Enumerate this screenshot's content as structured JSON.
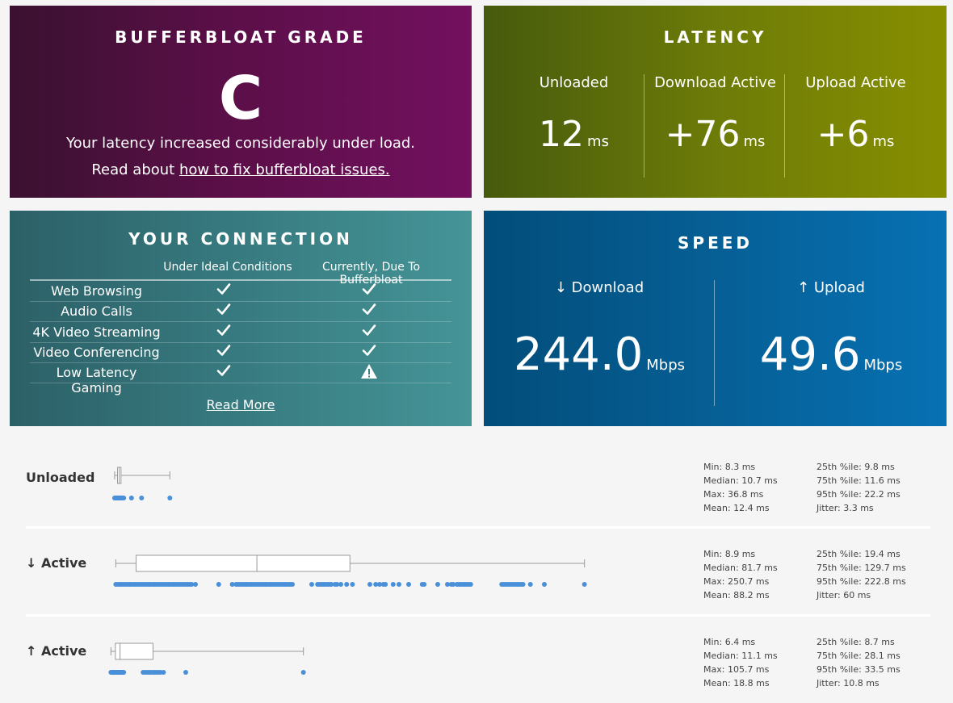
{
  "grade": {
    "title": "BUFFERBLOAT GRADE",
    "letter": "C",
    "message": "Your latency increased considerably under load.",
    "fix_prefix": "Read about ",
    "fix_link": "how to fix bufferbloat issues."
  },
  "latency": {
    "title": "LATENCY",
    "unit": "ms",
    "columns": [
      {
        "label": "Unloaded",
        "value": "12"
      },
      {
        "label": "Download Active",
        "value": "+76"
      },
      {
        "label": "Upload Active",
        "value": "+6"
      }
    ]
  },
  "connection": {
    "title": "YOUR CONNECTION",
    "col_ideal": "Under Ideal Conditions",
    "col_current": "Currently, Due To Bufferbloat",
    "rows": [
      {
        "label": "Web Browsing",
        "ideal": "check",
        "current": "check"
      },
      {
        "label": "Audio Calls",
        "ideal": "check",
        "current": "check"
      },
      {
        "label": "4K Video Streaming",
        "ideal": "check",
        "current": "check"
      },
      {
        "label": "Video Conferencing",
        "ideal": "check",
        "current": "check"
      },
      {
        "label": "Low Latency Gaming",
        "ideal": "check",
        "current": "warning"
      }
    ],
    "read_more": "Read More"
  },
  "speed": {
    "title": "SPEED",
    "unit": "Mbps",
    "download": {
      "label": "↓ Download",
      "value": "244.0"
    },
    "upload": {
      "label": "↑ Upload",
      "value": "49.6"
    }
  },
  "colors": {
    "dot": "#4a90d9",
    "box": "#999999"
  },
  "plots": [
    {
      "label": "Unloaded",
      "min": 8.3,
      "q1": 9.8,
      "median": 10.7,
      "q3": 11.6,
      "max": 36.8,
      "samples": [
        8.3,
        8.5,
        8.6,
        8.8,
        9.0,
        9.2,
        9.4,
        9.6,
        9.8,
        10.0,
        10.2,
        10.4,
        10.6,
        10.7,
        10.8,
        11.0,
        11.2,
        11.4,
        11.6,
        11.8,
        12.0,
        12.5,
        13.0,
        17.0,
        22.2,
        36.8
      ],
      "stats_left": [
        "Min: 8.3 ms",
        "Median: 10.7 ms",
        "Max: 36.8 ms",
        "Mean: 12.4 ms"
      ],
      "stats_right": [
        "25th %ile: 9.8 ms",
        "75th %ile: 11.6 ms",
        "95th %ile: 22.2 ms",
        "Jitter: 3.3 ms"
      ]
    },
    {
      "label": "↓ Active",
      "min": 8.9,
      "q1": 19.4,
      "median": 81.7,
      "q3": 129.7,
      "max": 250.7,
      "samples": [
        8.9,
        10,
        11,
        12,
        13,
        14,
        15,
        16,
        17,
        18,
        19,
        20,
        21,
        22,
        23,
        24,
        25,
        26,
        27,
        28,
        29,
        30,
        31,
        32,
        33,
        34,
        35,
        36,
        37,
        38,
        39,
        40,
        41,
        42,
        43,
        44,
        45,
        46,
        47,
        48,
        50,
        62,
        69,
        71,
        72,
        73,
        74,
        75,
        76,
        77,
        78,
        79,
        80,
        81,
        82,
        83,
        84,
        85,
        86,
        87,
        88,
        89,
        90,
        91,
        92,
        93,
        94,
        95,
        96,
        97,
        98,
        99,
        100,
        110,
        113,
        114,
        115,
        116,
        117,
        118,
        119,
        120,
        122,
        123,
        125,
        128,
        131,
        140,
        143,
        145,
        147,
        148,
        152,
        155,
        160,
        167,
        168,
        175,
        180,
        182,
        183,
        185,
        186,
        187,
        188,
        189,
        190,
        191,
        192,
        208,
        209,
        210,
        211,
        212,
        213,
        214,
        215,
        216,
        217,
        218,
        219,
        222.8,
        230,
        250.7
      ],
      "stats_left": [
        "Min: 8.9 ms",
        "Median: 81.7 ms",
        "Max: 250.7 ms",
        "Mean: 88.2 ms"
      ],
      "stats_right": [
        "25th %ile: 19.4 ms",
        "75th %ile: 129.7 ms",
        "95th %ile: 222.8 ms",
        "Jitter: 60 ms"
      ]
    },
    {
      "label": "↑ Active",
      "min": 6.4,
      "q1": 8.7,
      "median": 11.1,
      "q3": 28.1,
      "max": 105.7,
      "samples": [
        6.4,
        6.8,
        7.2,
        7.6,
        8.0,
        8.4,
        8.7,
        9.0,
        9.4,
        9.8,
        10.2,
        10.6,
        11.0,
        11.1,
        11.4,
        11.8,
        12.2,
        12.6,
        13.0,
        23.0,
        24.0,
        25.0,
        26.0,
        27.0,
        28.1,
        29.0,
        30.0,
        31.0,
        32.0,
        33.5,
        45.0,
        105.7
      ],
      "stats_left": [
        "Min: 6.4 ms",
        "Median: 11.1 ms",
        "Max: 105.7 ms",
        "Mean: 18.8 ms"
      ],
      "stats_right": [
        "25th %ile: 8.7 ms",
        "75th %ile: 28.1 ms",
        "95th %ile: 33.5 ms",
        "Jitter: 10.8 ms"
      ]
    }
  ]
}
